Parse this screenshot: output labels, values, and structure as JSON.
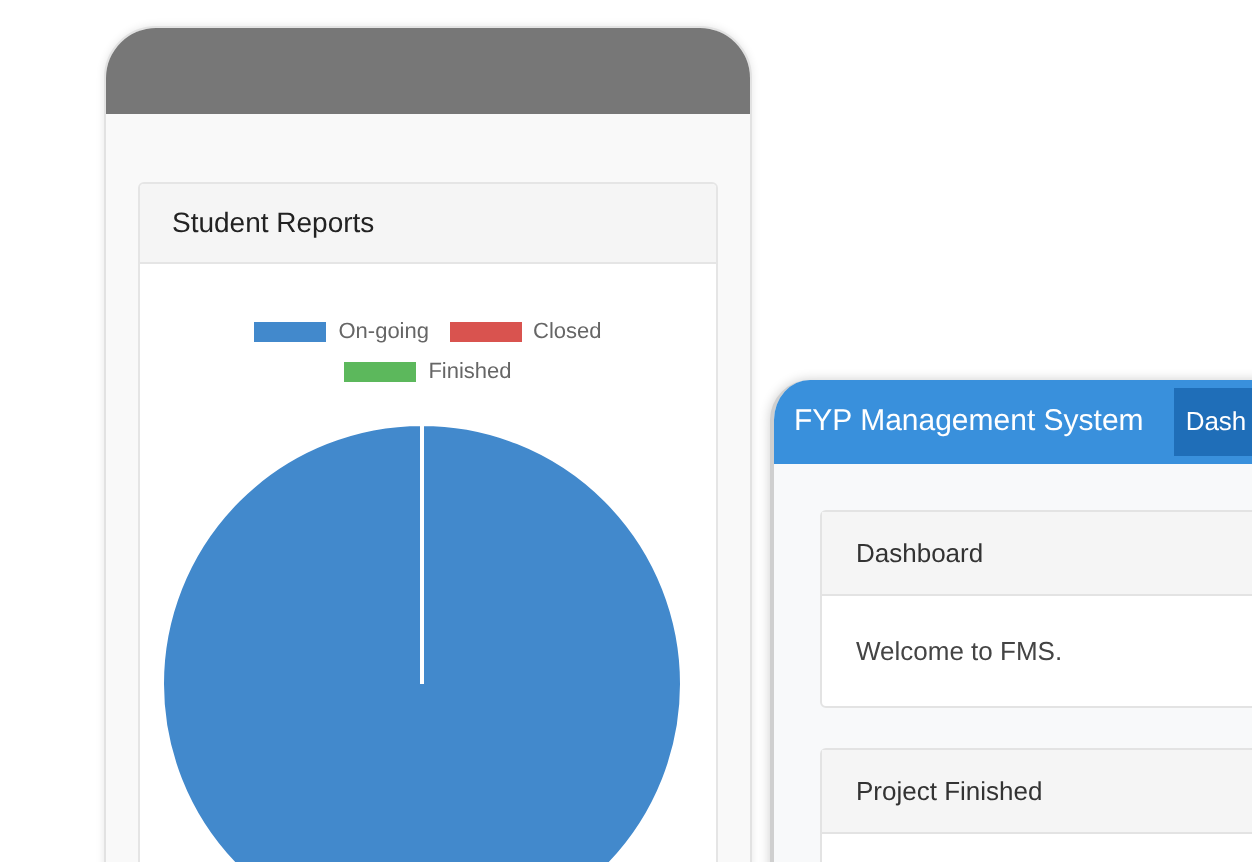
{
  "left_device": {
    "card": {
      "title": "Student Reports",
      "chart_data": {
        "type": "pie",
        "categories": [
          "On-going",
          "Closed",
          "Finished"
        ],
        "values": [
          1,
          0,
          0
        ],
        "colors": [
          "#4289cc",
          "#d9534f",
          "#5cb85c"
        ]
      }
    }
  },
  "right_device": {
    "navbar": {
      "brand": "FYP Management System",
      "tabs": [
        {
          "label": "Dash",
          "selected": true
        }
      ]
    },
    "cards": [
      {
        "title": "Dashboard",
        "body": "Welcome to FMS."
      },
      {
        "title": "Project Finished"
      }
    ]
  }
}
